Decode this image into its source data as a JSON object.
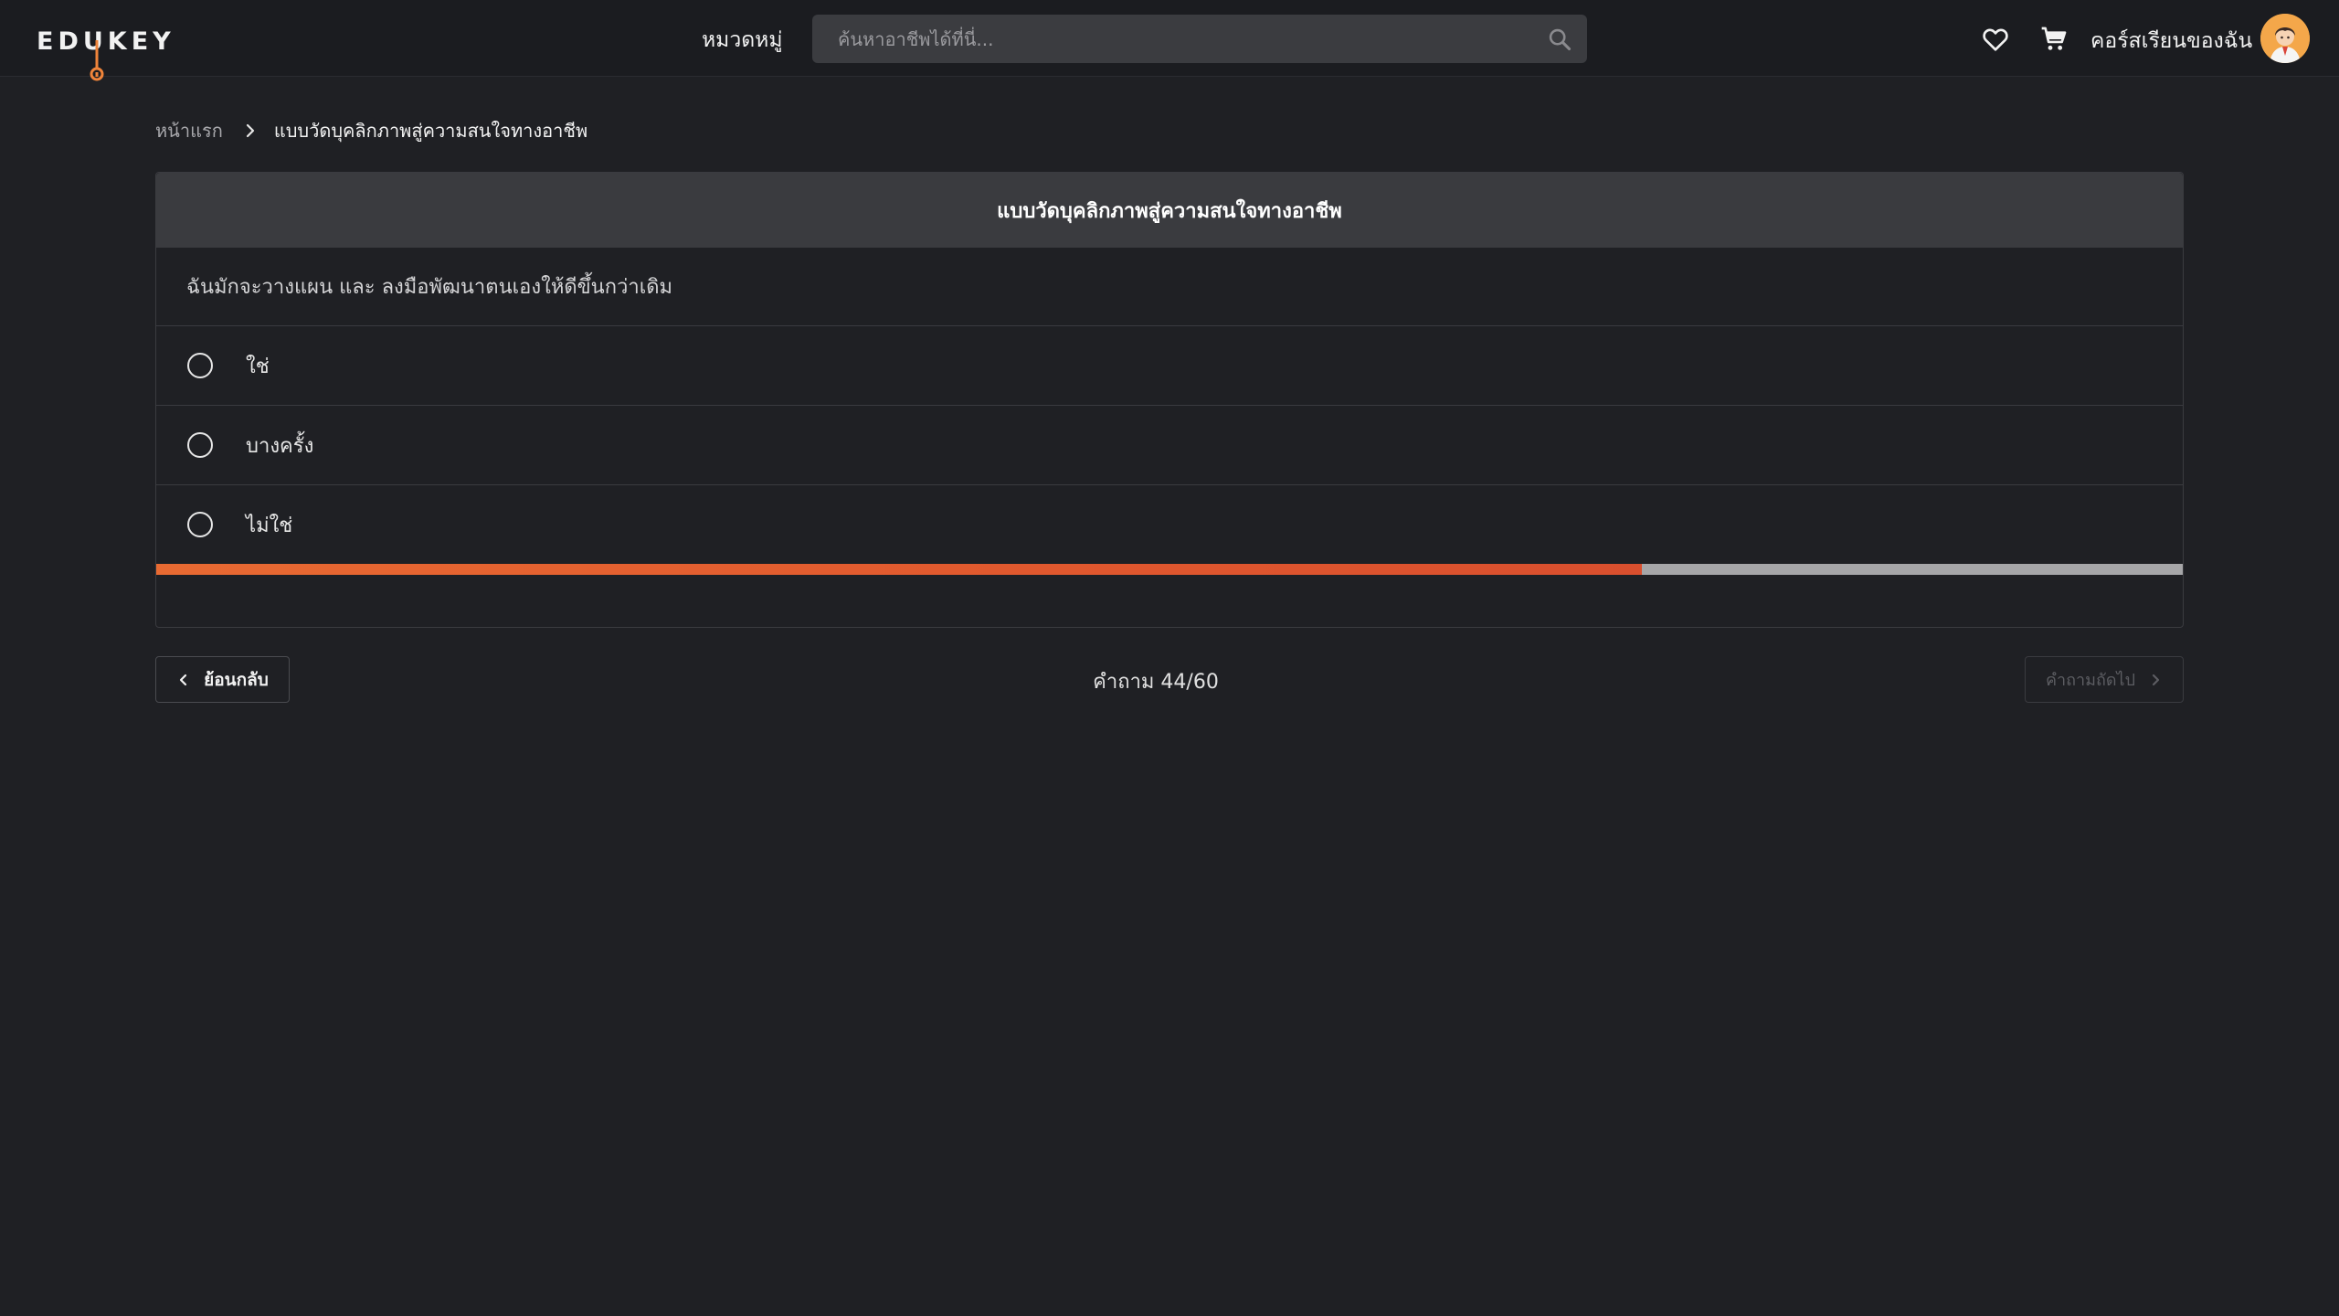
{
  "header": {
    "logo_text": "EDUKEY",
    "nav_categories": "หมวดหมู่",
    "search_placeholder": "ค้นหาอาชีพได้ที่นี่...",
    "my_courses": "คอร์สเรียนของฉัน",
    "icons": [
      "heart-icon",
      "cart-icon",
      "search-icon"
    ]
  },
  "breadcrumb": {
    "home": "หน้าแรก",
    "current": "แบบวัดบุคลิกภาพสู่ความสนใจทางอาชีพ"
  },
  "quiz": {
    "title": "แบบวัดบุคลิกภาพสู่ความสนใจทางอาชีพ",
    "question": "ฉันมักจะวางแผน และ ลงมือพัฒนาตนเองให้ดีขึ้นกว่าเดิม",
    "options": [
      {
        "label": "ใช่"
      },
      {
        "label": "บางครั้ง"
      },
      {
        "label": "ไม่ใช่"
      }
    ],
    "progress_fraction": 0.733
  },
  "footer_nav": {
    "back_label": "ย้อนกลับ",
    "counter": "คำถาม 44/60",
    "next_label": "คำถามถัดไป"
  },
  "colors": {
    "accent": "#e0582e",
    "background": "#1f2024",
    "header_bar": "#3a3b3f"
  }
}
